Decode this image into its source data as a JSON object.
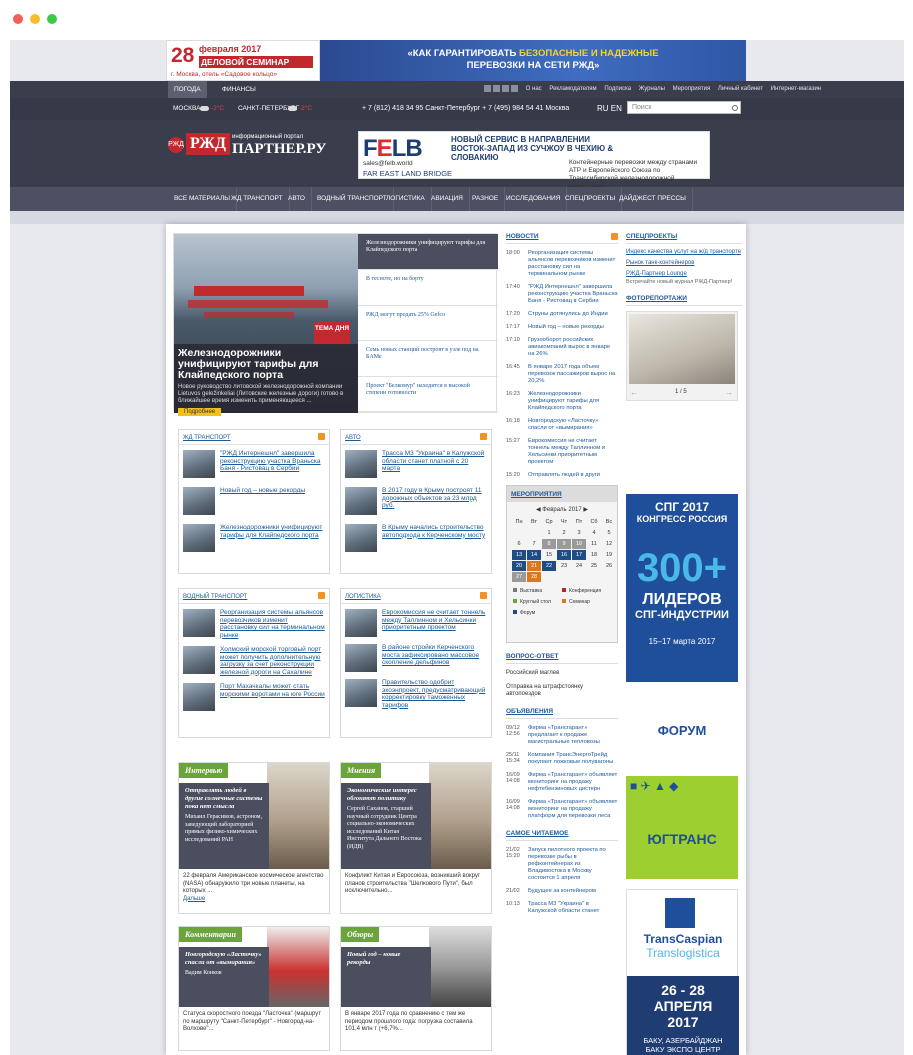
{
  "promo": {
    "seminar_day": "28",
    "seminar_month": "февраля 2017",
    "seminar_label": "ДЕЛОВОЙ СЕМИНАР",
    "seminar_place": "г. Москва, отель «Садовое кольцо»",
    "banner_line1a": "«КАК ГАРАНТИРОВАТЬ ",
    "banner_line1b": "БЕЗОПАСНЫЕ И НАДЕЖНЫЕ",
    "banner_line2": "ПЕРЕВОЗКИ НА СЕТИ РЖД»"
  },
  "topbar": {
    "tab_weather": "ПОГОДА",
    "tab_finance": "ФИНАНСЫ",
    "links": [
      "О нас",
      "Рекламодателям",
      "Подписка",
      "Журналы",
      "Мероприятия",
      "Личный кабинет",
      "Интернет-магазин"
    ]
  },
  "cities": {
    "moscow": "МОСКВА",
    "moscow_temp": "-2°С",
    "spb": "САНКТ-ПЕТЕРБУРГ",
    "spb_temp": "-2°С"
  },
  "phones": "+ 7 (812) 418 34 95 Санкт-Петербург  + 7 (495) 984 54 41 Москва",
  "lang": {
    "ru": "RU",
    "en": "EN"
  },
  "search": {
    "placeholder": "Поиск"
  },
  "logo": {
    "badge": "РЖД",
    "rzd": "РЖД",
    "sub": "информационный портал",
    "name": "ПАРТНЕР.РУ"
  },
  "felb": {
    "logo_f": "F",
    "logo_e": "E",
    "logo_lb": "LB",
    "mail": "sales@felb.world",
    "fe": "FAR EAST LAND BRIDGE",
    "head": "НОВЫЙ СЕРВИС В НАПРАВЛЕНИИ ВОСТОК-ЗАПАД ИЗ СУЧЖОУ В ЧЕХИЮ & СЛОВАКИЮ",
    "text": "Контейнерные перевозки между странами АТР и Европейского Союза по Транссибирской железнодорожной магистрали."
  },
  "nav": [
    "ВСЕ МАТЕРИАЛЫ",
    "ЖД ТРАНСПОРТ",
    "АВТО",
    "ВОДНЫЙ ТРАНСПОРТ",
    "ЛОГИСТИКА",
    "АВИАЦИЯ",
    "РАЗНОЕ",
    "ИССЛЕДОВАНИЯ",
    "СПЕЦПРОЕКТЫ",
    "ДАЙДЖЕСТ ПРЕССЫ"
  ],
  "hero": {
    "badge": "ТЕМА ДНЯ",
    "title": "Железнодорожники унифицируют тарифы для Клайпедского порта",
    "text": "Новое руководство литовской железнодорожной компании Lietuvos geležinkeliai (Литовские железные дороги) готово в ближайшее время изменить применяющееся ...",
    "more": "Подробнее",
    "list": [
      "Железнодорожники унифицируют тарифы для Клайпедского порта",
      "В тесноте, но на борту",
      "РЖД могут продать 25% Gefco",
      "Семь новых станций построят в узле под на БАМе",
      "Проект \"Белкомур\" находится в высокой степени готовности"
    ]
  },
  "boxes": [
    {
      "title": "ЖД ТРАНСПОРТ",
      "items": [
        "\"РЖД Интернешнл\" завершила реконструкцию участка Враньска Баня - Ристовац в Сербии",
        "Новый год – новые рекорды",
        "Железнодорожники унифицируют тарифы для Клайпедского порта"
      ]
    },
    {
      "title": "АВТО",
      "items": [
        "Трасса М3 \"Украина\" в Калужской области станет платной с 20 марта",
        "В 2017 году в Крыму построят 11 дорожных объектов за 23 млрд руб.",
        "В Крыму начались строительство автоподхода к Керченскому мосту"
      ]
    },
    {
      "title": "ВОДНЫЙ ТРАНСПОРТ",
      "items": [
        "Реорганизация системы альянсов перевозчиков изменит расстановку сил на терминальном рынке",
        "Холмский морской торговый порт может получить дополнительную загрузку за счет реконструкции железной дороги на Сахалине",
        "Порт Махачкалы может стать морскими воротами на юге России"
      ]
    },
    {
      "title": "ЛОГИСТИКА",
      "items": [
        "Еврокомиссия не считает тоннель между Таллинном и Хельсинки приоритетным проектом",
        "В районе стройки Керченского моста зафиксировано массовое скопление дельфинов",
        "Правительство одобрит экоэнпроект, предусматривающий корректировку таможенных тарифов"
      ]
    }
  ],
  "rubrics": [
    {
      "tag": "Интервью",
      "title": "Отправлять людей в другие солнечные системы пока нет смысла",
      "text": "Михаил Герасимов, астроном, заведующий лабораторией прямых физико-химических исследований РАН",
      "lead": "22 февраля Американское космическое агентство (NASA) обнаружило три новые планеты, на которых ...",
      "more": "Дальше"
    },
    {
      "tag": "Мнения",
      "title": "Экономические интерес обгоняют политику",
      "text": "Сергей Саханов, старший научный сотрудник Центра социально-экономических исследований Китая Института Дальнего Востока (ИДВ)",
      "lead": "Конфликт Китая и Евросоюза, возникший вокруг планов строительства \"Шелкового Пути\", был исключительно...",
      "more": ""
    },
    {
      "tag": "Комментарии",
      "title": "Новгородскую «Ласточку» спасли от «вымирания»",
      "text": "Вадим Конков",
      "lead": "Статуса скоростного поезда \"Ласточка\" (маршрут по маршруту \"Санкт-Петербург\" - Новгород-на-Волхове\"...",
      "more": ""
    },
    {
      "tag": "Обзоры",
      "title": "Новый год – новые рекорды",
      "text": "",
      "lead": "В январе 2017 года по сравнению с тем же периодом прошлого года: погрузка составила 101,4 млн т (+6,7%...",
      "more": ""
    }
  ],
  "news": {
    "title": "НОВОСТИ",
    "items": [
      {
        "t": "18:00",
        "x": "Реорганизация системы альянсов перевозчиков изменит расстановку сил на терминальном рынке"
      },
      {
        "t": "17:40",
        "x": "\"РЖД Интернешнл\" завершила реконструкцию участка Враньска Баня - Ристовац в Сербии"
      },
      {
        "t": "17:20",
        "x": "Струны дотянулись до Индии"
      },
      {
        "t": "17:17",
        "x": "Новый год – новые рекорды"
      },
      {
        "t": "17:10",
        "x": "Грузооборот российских авиакомпаний вырос в январе на 26%"
      },
      {
        "t": "16:45",
        "x": "В январе 2017 года объем перевозок пассажиров вырос на 20,2%"
      },
      {
        "t": "16:23",
        "x": "Железнодорожники унифицируют тарифы для Клайпедского порта"
      },
      {
        "t": "16:18",
        "x": "Новгородскую «Ласточку» спасли от «вымирания»"
      },
      {
        "t": "15:27",
        "x": "Еврокомиссия не считает тоннель между Таллинном и Хельсинки приоритетным проектом"
      },
      {
        "t": "15:20",
        "x": "Отправлять людей в други"
      }
    ]
  },
  "calendar": {
    "title": "МЕРОПРИЯТИЯ",
    "month": "Февраль 2017",
    "days": [
      "Пн",
      "Вт",
      "Ср",
      "Чт",
      "Пт",
      "Сб",
      "Вс"
    ],
    "cells": [
      "",
      "",
      "1",
      "2",
      "3",
      "4",
      "5",
      "6",
      "7",
      "8",
      "9",
      "10",
      "11",
      "12",
      "13",
      "14",
      "15",
      "16",
      "17",
      "18",
      "19",
      "20",
      "21",
      "22",
      "23",
      "24",
      "25",
      "26",
      "27",
      "28",
      "",
      "",
      "",
      "",
      ""
    ],
    "legend": [
      "Выставка",
      "Конференция",
      "Круглый стол",
      "Семинар",
      "Форум"
    ]
  },
  "qa": {
    "title": "ВОПРОС-ОТВЕТ",
    "items": [
      "Российский маглев",
      "Отправка на штрафстоянку автопоездов"
    ]
  },
  "ads": {
    "title": "ОБЪЯВЛЕНИЯ",
    "items": [
      {
        "t": "09/12 12:56",
        "x": "Фирма «Трансгарант» предлагает к продаже магистральные тепловозы"
      },
      {
        "t": "25/11 15:34",
        "x": "Компания ТрансЭнергоТрейд покупает ложковые полувагоны"
      },
      {
        "t": "16/09 14:08",
        "x": "Фирма «Трансгарант» объявляет мониторинг на продажу нефтебензиновых цистерн"
      },
      {
        "t": "16/09 14:08",
        "x": "Фирма «Трансгарант» объявляет мониторинг на продажу платформ для перевозки леса"
      }
    ]
  },
  "popular": {
    "title": "САМОЕ ЧИТАЕМОЕ",
    "items": [
      {
        "t": "21/02 15:20",
        "x": "Запуск пилотного проекта по перевозке рыбы в рефконтейнерах из Владивостока в Москву состоится 1 апреля"
      },
      {
        "t": "21/02",
        "x": "Будущее за контейнером"
      },
      {
        "t": "10:13",
        "x": "Трасса М3 \"Украина\" в Калужской области станет"
      }
    ]
  },
  "spec": {
    "title": "СПЕЦПРОЕКТЫ",
    "items": [
      "Индекс качества услуг на ж/д транспорте",
      "Рынок танк-контейнеров",
      "РЖД-Партнер Lounge"
    ],
    "note": "Встречайте новый журнал РЖД-Партнер!"
  },
  "photo": {
    "title": "ФОТОРЕПОРТАЖИ",
    "counter": "1 / 5"
  },
  "banner1": {
    "l1": "СПГ 2017",
    "l2": "КОНГРЕСС РОССИЯ",
    "big": "300+",
    "l3": "ЛИДЕРОВ",
    "l4": "СПГ-ИНДУСТРИИ",
    "date": "15–17 марта 2017"
  },
  "banner2": {
    "l1": "ФОРУМ",
    "l2": "ЮГТРАНС"
  },
  "banner3": {
    "l1": "TransCaspian",
    "l2": "Translogistica",
    "d1": "26 - 28",
    "d2": "АПРЕЛЯ",
    "d3": "2017",
    "d4": "БАКУ, АЗЕРБАЙДЖАН",
    "d5": "БАКУ ЭКСПО ЦЕНТР"
  },
  "colors": {
    "dark": "#3a3d4c",
    "accent": "#c2282d",
    "green": "#6ba53a",
    "link": "#1d5a9a"
  }
}
